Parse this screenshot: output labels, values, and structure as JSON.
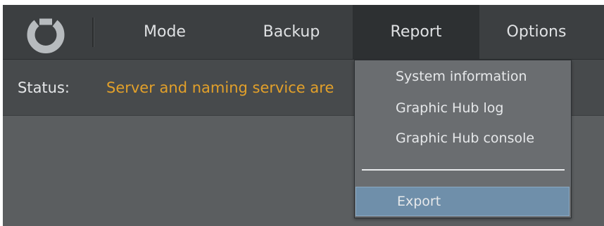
{
  "nav": {
    "mode": "Mode",
    "backup": "Backup",
    "report": "Report",
    "options": "Options"
  },
  "status": {
    "label": "Status:",
    "text": "Server and naming service are",
    "text_color": "#e2a02a"
  },
  "report_menu": {
    "items": [
      "System information",
      "Graphic Hub log",
      "Graphic Hub console"
    ],
    "export": "Export"
  },
  "icons": {
    "logo": "logo-icon"
  },
  "colors": {
    "topbar": "#3c3f41",
    "statusbar": "#474a4c",
    "menu": "#6a6d70",
    "highlight": "#6f8faa"
  }
}
